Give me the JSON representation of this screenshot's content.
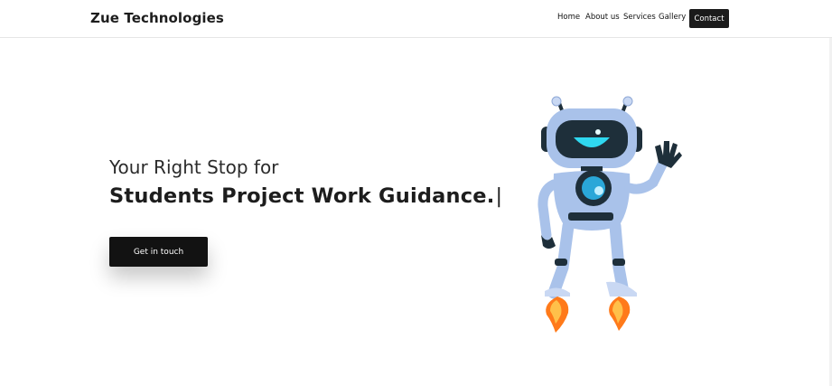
{
  "header": {
    "brand": "Zue Technologies",
    "nav": {
      "home": "Home",
      "about": "About us",
      "services": "Services",
      "gallery": "Gallery",
      "contact": "Contact"
    }
  },
  "hero": {
    "line1": "Your Right Stop for",
    "line2": "Students Project Work Guidance.",
    "caret": "|",
    "cta": "Get in touch"
  },
  "illustration": {
    "name": "robot-mascot"
  },
  "colors": {
    "dark": "#1b1b1b",
    "robot_body": "#a9c2ea",
    "robot_face": "#1e2f3a",
    "accent_cyan": "#2fd8f0",
    "flame": "#ff7a1a"
  }
}
